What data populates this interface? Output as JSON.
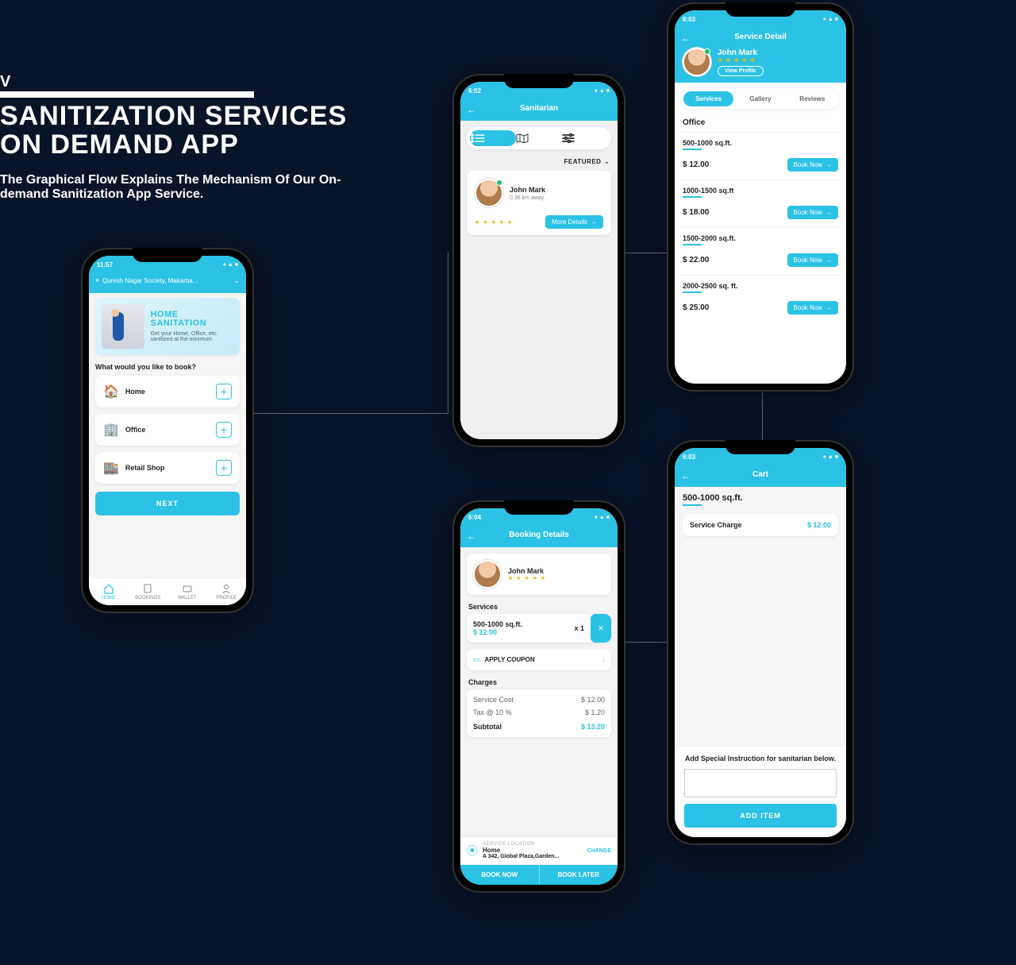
{
  "page": {
    "eyebrow": "V",
    "title_line1": "SANITIZATION SERVICES",
    "title_line2": "ON DEMAND APP",
    "subtitle": "The Graphical Flow Explains The Mechanism Of Our On-demand Sanitization App Service."
  },
  "p1": {
    "time": "11:57",
    "address": "Quresh Nagar Society, Makarba...",
    "banner_title": "HOME SANITATION",
    "banner_sub": "Get your Home, Office, etc. sanitized at the minimum",
    "prompt": "What would you like to book?",
    "options": {
      "home": "Home",
      "office": "Office",
      "retail": "Retail Shop"
    },
    "next": "NEXT",
    "nav": {
      "home": "HOME",
      "bookings": "BOOKINGS",
      "wallet": "WALLET",
      "profile": "PROFILE"
    }
  },
  "p2": {
    "time": "6:02",
    "title": "Sanitarian",
    "featured": "FEATURED",
    "name": "John Mark",
    "distance": "0.36 km away",
    "more": "More Details"
  },
  "p3": {
    "time": "6:03",
    "title": "Service Detail",
    "name": "John Mark",
    "view_profile": "View Profile",
    "tabs": {
      "services": "Services",
      "gallery": "Gallery",
      "reviews": "Reviews"
    },
    "section": "Office",
    "items": [
      {
        "label": "500-1000 sq.ft.",
        "price": "$ 12.00"
      },
      {
        "label": "1000-1500 sq.ft",
        "price": "$ 18.00"
      },
      {
        "label": "1500-2000 sq.ft.",
        "price": "$ 22.00"
      },
      {
        "label": "2000-2500 sq. ft.",
        "price": "$ 25.00"
      }
    ],
    "book": "Book Now"
  },
  "p4": {
    "time": "6:04",
    "title": "Booking Details",
    "name": "John Mark",
    "services_label": "Services",
    "item_label": "500-1000 sq.ft.",
    "item_price": "$ 12.00",
    "item_qty": "x 1",
    "coupon": "APPLY COUPON",
    "charges_label": "Charges",
    "charges": {
      "service_cost_l": "Service Cost",
      "service_cost_v": "$ 12.00",
      "tax_l": "Tax @ 10 %",
      "tax_v": "$ 1.20",
      "subtotal_l": "Subtotal",
      "subtotal_v": "$ 13.20"
    },
    "loc_title": "SERVICE LOCATION",
    "loc_change": "CHANGE",
    "loc_name": "Home",
    "loc_addr": "A 342, Global Plaza,Garden...",
    "book_now": "BOOK NOW",
    "book_later": "BOOK LATER"
  },
  "p5": {
    "time": "6:03",
    "title": "Cart",
    "heading": "500-1000 sq.ft.",
    "row_l": "Service Charge",
    "row_v": "$ 12.00",
    "instruction": "Add Special Instruction for sanitarian below.",
    "add": "ADD ITEM"
  }
}
